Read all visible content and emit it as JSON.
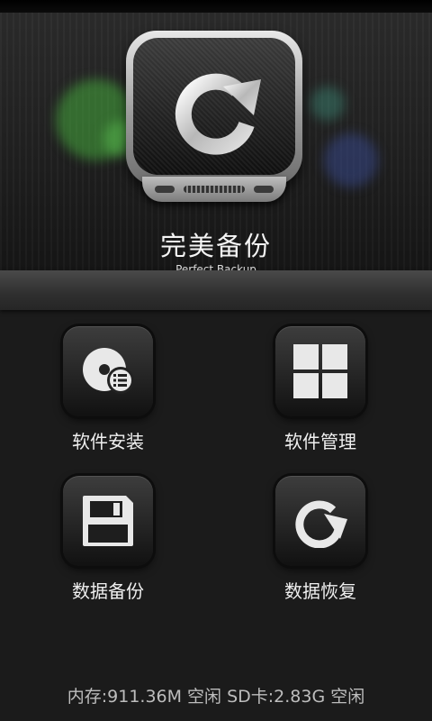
{
  "app": {
    "title": "完美备份",
    "subtitle": "Perfect Backup",
    "logo_icon": "refresh-icon"
  },
  "menu": [
    {
      "label": "软件安装",
      "icon": "disc-list-icon"
    },
    {
      "label": "软件管理",
      "icon": "grid-icon"
    },
    {
      "label": "数据备份",
      "icon": "floppy-disk-icon"
    },
    {
      "label": "数据恢复",
      "icon": "restore-icon"
    }
  ],
  "footer": {
    "storage_text": "内存:911.36M 空闲 SD卡:2.83G 空闲"
  },
  "colors": {
    "background": "#1b1b1b",
    "tile": "#2b2b2b",
    "text": "#f0f0f0",
    "footer_text": "#bdbdbd"
  }
}
